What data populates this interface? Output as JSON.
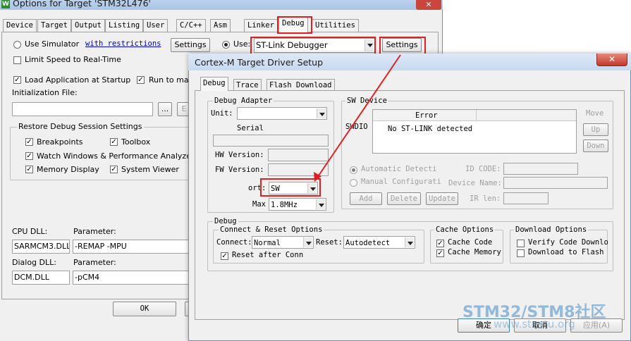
{
  "bg": {
    "title": "Options for Target 'STM32L476'",
    "close": "✕",
    "tabs": [
      "Device",
      "Target",
      "Output",
      "Listing",
      "User",
      "C/C++",
      "Asm",
      "Linker",
      "Debug",
      "Utilities"
    ],
    "use_simulator": "Use Simulator",
    "with_restrictions": "with restrictions",
    "settings1": "Settings",
    "use_label": "Use:",
    "use_value": "ST-Link Debugger",
    "settings2": "Settings",
    "limit_speed": "Limit Speed to Real-Time",
    "load_app": "Load Application at Startup",
    "run_to_main": "Run to main",
    "init_file": "Initialization File:",
    "browse": "...",
    "edit": "E",
    "restore_title": "Restore Debug Session Settings",
    "breakpoints": "Breakpoints",
    "toolbox": "Toolbox",
    "watch_windows": "Watch Windows & Performance Analyzer",
    "memory_display": "Memory Display",
    "system_viewer": "System Viewer",
    "cpu_dll": "CPU DLL:",
    "parameter1": "Parameter:",
    "cpu_dll_value": "SARMCM3.DLL",
    "cpu_param_value": "-REMAP -MPU",
    "dialog_dll": "Dialog DLL:",
    "parameter2": "Parameter:",
    "dialog_dll_value": "DCM.DLL",
    "dialog_param_value": "-pCM4",
    "ok": "OK"
  },
  "fg": {
    "title": "Cortex-M Target Driver Setup",
    "close": "✕",
    "tabs": [
      "Debug",
      "Trace",
      "Flash Download"
    ],
    "debug_adapter": "Debug Adapter",
    "unit": "Unit:",
    "serial": "Serial",
    "hw_version": "HW Version:",
    "fw_version": "FW Version:",
    "port": "ort:",
    "port_value": "SW",
    "max": "Max",
    "max_value": "1.8MHz",
    "sw_device": "SW Device",
    "error_col": "Error",
    "swdio": "SWDIO",
    "no_stlink": "No ST-LINK detected",
    "move": "Move",
    "up": "Up",
    "down": "Down",
    "auto_detect": "Automatic Detecti",
    "manual_config": "Manual Configurati",
    "id_code": "ID CODE:",
    "device_name": "Device Name:",
    "ir_len": "IR len:",
    "add": "Add",
    "delete": "Delete",
    "update": "Update",
    "debug_group": "Debug",
    "connect_reset": "Connect & Reset Options",
    "connect": "Connect:",
    "connect_value": "Normal",
    "reset": "Reset:",
    "reset_value": "Autodetect",
    "reset_after": "Reset after Conn",
    "cache_options": "Cache Options",
    "cache_code": "Cache Code",
    "cache_memory": "Cache Memory",
    "download_options": "Download Options",
    "verify_code": "Verify Code Downlo",
    "download_flash": "Download to Flash",
    "ok": "确定",
    "cancel": "取消",
    "apply": "应用(A)"
  },
  "watermark": {
    "line1": "STM32/STM8社区",
    "line2": "www.stmcu.org"
  },
  "colors": {
    "highlight": "#e02020"
  }
}
